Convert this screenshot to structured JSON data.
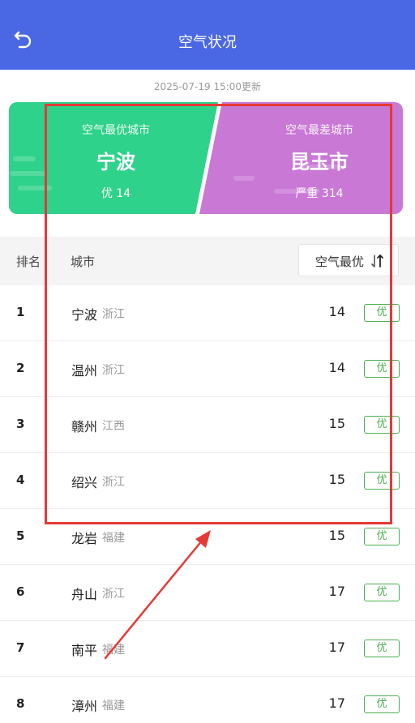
{
  "header": {
    "title": "空气状况",
    "back_icon": "back-arrow-icon"
  },
  "update_time": "2025-07-19 15:00更新",
  "banner": {
    "best": {
      "label": "空气最优城市",
      "city": "宁波",
      "value": "优 14",
      "color": "#2fd28a"
    },
    "worst": {
      "label": "空气最差城市",
      "city": "昆玉市",
      "value": "严重 314",
      "color": "#c978d6"
    }
  },
  "table": {
    "col_rank": "排名",
    "col_city": "城市",
    "sort_label": "空气最优",
    "sort_icon": "sort-arrows-icon",
    "rows": [
      {
        "rank": "1",
        "city": "宁波",
        "province": "浙江",
        "aqi": "14",
        "level": "优"
      },
      {
        "rank": "2",
        "city": "温州",
        "province": "浙江",
        "aqi": "14",
        "level": "优"
      },
      {
        "rank": "3",
        "city": "赣州",
        "province": "江西",
        "aqi": "15",
        "level": "优"
      },
      {
        "rank": "4",
        "city": "绍兴",
        "province": "浙江",
        "aqi": "15",
        "level": "优"
      },
      {
        "rank": "5",
        "city": "龙岩",
        "province": "福建",
        "aqi": "15",
        "level": "优"
      },
      {
        "rank": "6",
        "city": "舟山",
        "province": "浙江",
        "aqi": "17",
        "level": "优"
      },
      {
        "rank": "7",
        "city": "南平",
        "province": "福建",
        "aqi": "17",
        "level": "优"
      },
      {
        "rank": "8",
        "city": "漳州",
        "province": "福建",
        "aqi": "17",
        "level": "优"
      }
    ]
  },
  "colors": {
    "header_bg": "#4a68e3",
    "level_good": "#4caf50",
    "annotation": "#e53935"
  }
}
